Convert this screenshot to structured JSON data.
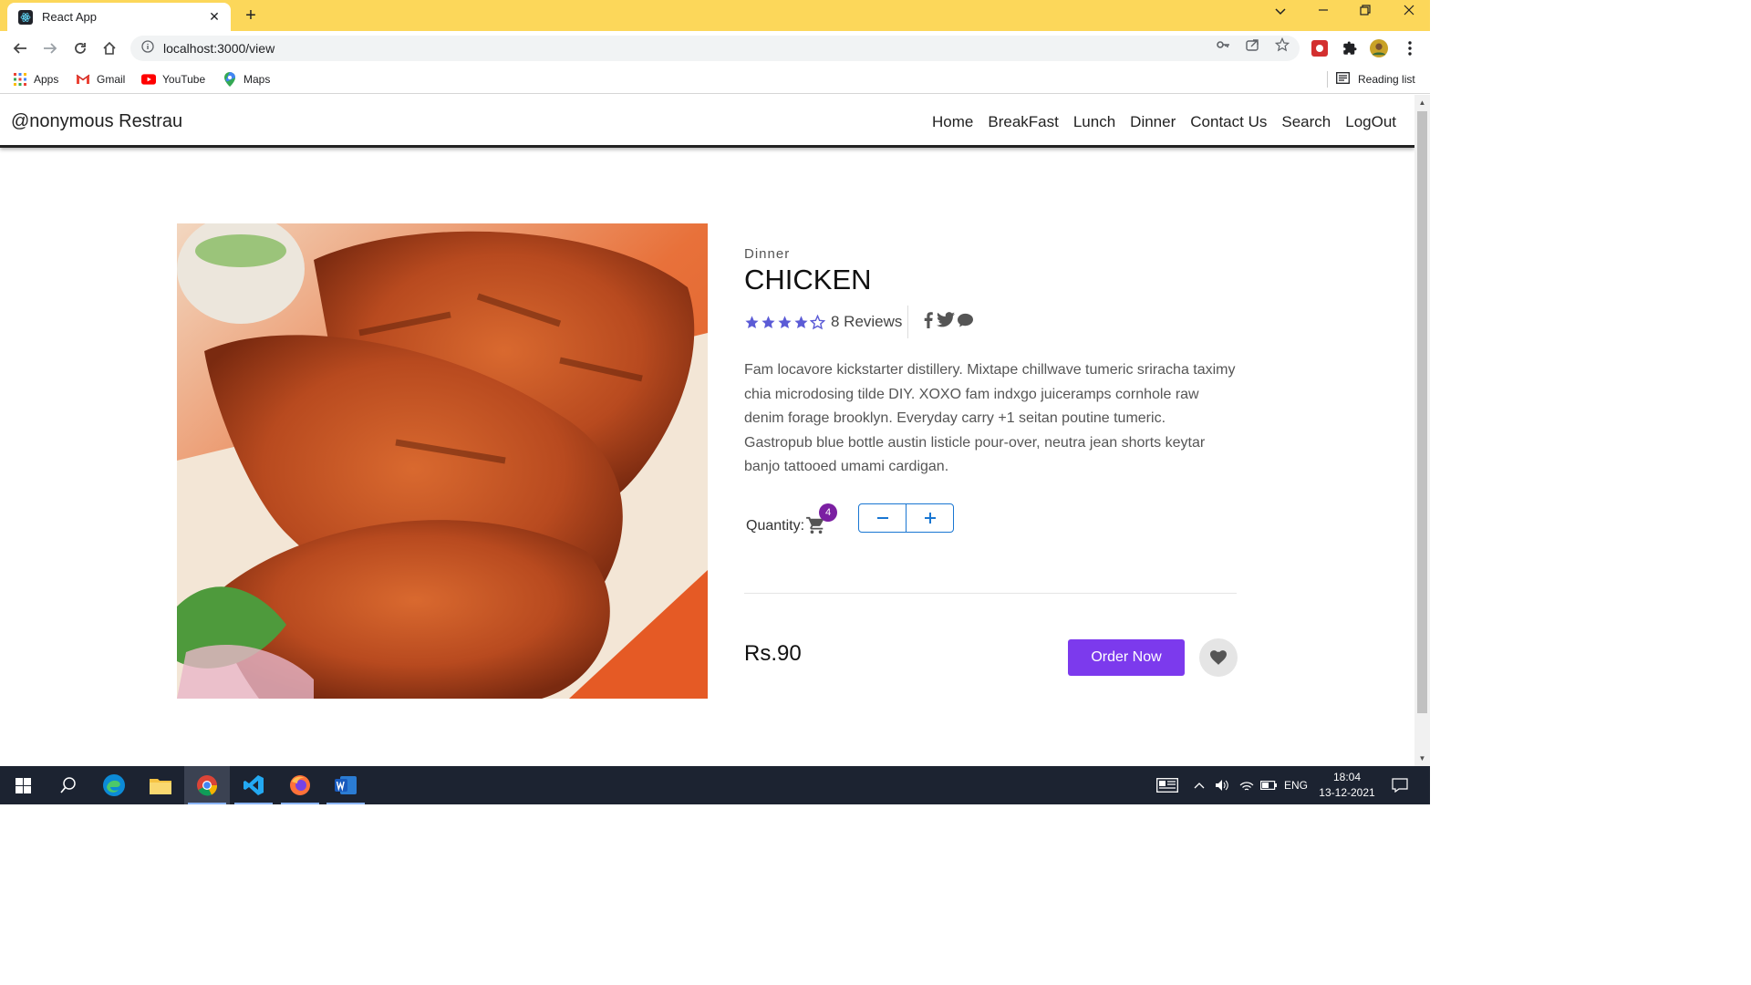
{
  "browser": {
    "tab_title": "React App",
    "url": "localhost:3000/view",
    "bookmarks": [
      {
        "label": "Apps",
        "icon": "apps-grid-icon"
      },
      {
        "label": "Gmail",
        "icon": "gmail-icon"
      },
      {
        "label": "YouTube",
        "icon": "youtube-icon"
      },
      {
        "label": "Maps",
        "icon": "maps-icon"
      }
    ],
    "reading_list": "Reading list"
  },
  "site": {
    "brand": "@nonymous Restrau",
    "menu": [
      "Home",
      "BreakFast",
      "Lunch",
      "Dinner",
      "Contact Us",
      "Search",
      "LogOut"
    ]
  },
  "product": {
    "category": "Dinner",
    "name": "CHICKEN",
    "rating": 4,
    "rating_max": 5,
    "reviews": "8 Reviews",
    "description": "Fam locavore kickstarter distillery. Mixtape chillwave tumeric sriracha taximy chia microdosing tilde DIY. XOXO fam indxgo juiceramps cornhole raw denim forage brooklyn. Everyday carry +1 seitan poutine tumeric. Gastropub blue bottle austin listicle pour-over, neutra jean shorts keytar banjo tattooed umami cardigan.",
    "quantity_label": "Quantity:",
    "cart_count": "4",
    "price": "Rs.90",
    "order_label": "Order Now"
  },
  "taskbar": {
    "lang": "ENG",
    "time": "18:04",
    "date": "13-12-2021"
  },
  "colors": {
    "tab_bar": "#fcd75a",
    "accent": "#7c3aed",
    "badge": "#7b1fa2",
    "star": "#5b5bd6",
    "stepper": "#1976d2"
  }
}
